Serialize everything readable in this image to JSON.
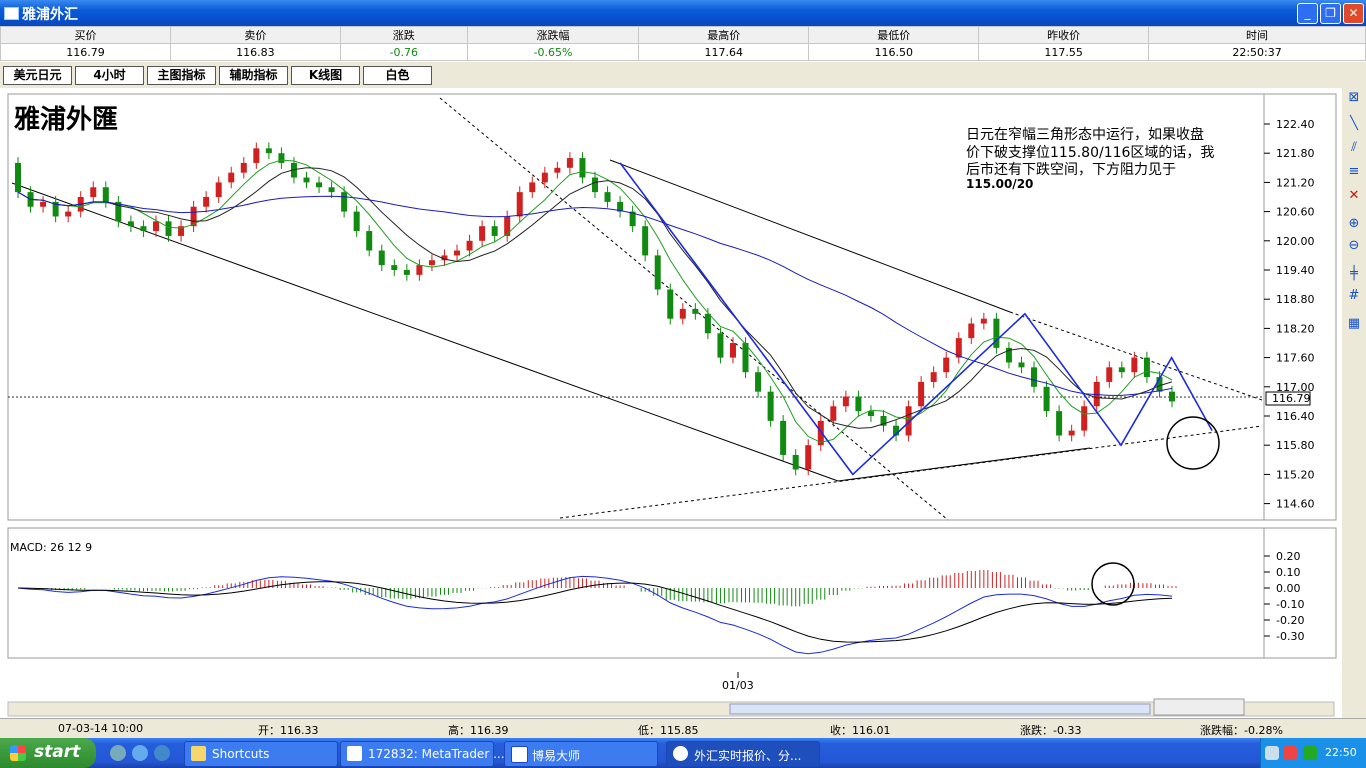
{
  "window": {
    "title": "雅浦外汇"
  },
  "quote": {
    "headers": [
      "买价",
      "卖价",
      "涨跌",
      "涨跌幅",
      "最高价",
      "最低价",
      "昨收价",
      "时间"
    ],
    "values": [
      "116.79",
      "116.83",
      "-0.76",
      "-0.65%",
      "117.64",
      "116.50",
      "117.55",
      "22:50:37"
    ]
  },
  "toolbar": {
    "buttons": [
      "美元日元",
      "4小时",
      "主图指标",
      "辅助指标",
      "K线图",
      "白色"
    ]
  },
  "chart": {
    "watermark": "雅浦外匯",
    "annotation_lines": [
      "日元在窄幅三角形态中运行，如果收盘",
      "价下破支撑位115.80/116区域的话，我",
      "后市还有下跌空间，下方阻力见于",
      "115.00/20"
    ],
    "price_labels": [
      "122.40",
      "121.80",
      "121.20",
      "120.60",
      "120.00",
      "119.40",
      "118.80",
      "118.20",
      "117.60",
      "117.00",
      "116.40",
      "115.80",
      "115.20",
      "114.60"
    ],
    "current_price": "116.79",
    "macd_label": "MACD: 26 12 9",
    "macd_labels": [
      "0.20",
      "0.10",
      "0.00",
      "-0.10",
      "-0.20",
      "-0.30"
    ],
    "date_label": "01/03",
    "colors": {
      "up": "#d02020",
      "down": "#108a10",
      "ma_long": "#1b1bc0",
      "ma_fast": "#20a020",
      "ma_slow": "#222222",
      "zigzag": "#1b2be0"
    }
  },
  "chart_data": {
    "type": "candlestick",
    "title": "",
    "xlabel": "",
    "ylabel": "",
    "ylim": [
      114.3,
      122.7
    ],
    "points": [
      [
        121.6,
        121.0
      ],
      [
        121.0,
        120.7
      ],
      [
        120.7,
        120.8
      ],
      [
        120.8,
        120.5
      ],
      [
        120.5,
        120.6
      ],
      [
        120.6,
        120.9
      ],
      [
        120.9,
        121.1
      ],
      [
        121.1,
        120.8
      ],
      [
        120.8,
        120.4
      ],
      [
        120.4,
        120.3
      ],
      [
        120.3,
        120.2
      ],
      [
        120.2,
        120.4
      ],
      [
        120.4,
        120.1
      ],
      [
        120.1,
        120.3
      ],
      [
        120.3,
        120.7
      ],
      [
        120.7,
        120.9
      ],
      [
        120.9,
        121.2
      ],
      [
        121.2,
        121.4
      ],
      [
        121.4,
        121.6
      ],
      [
        121.6,
        121.9
      ],
      [
        121.9,
        121.8
      ],
      [
        121.8,
        121.6
      ],
      [
        121.6,
        121.3
      ],
      [
        121.3,
        121.2
      ],
      [
        121.2,
        121.1
      ],
      [
        121.1,
        121.0
      ],
      [
        121.0,
        120.6
      ],
      [
        120.6,
        120.2
      ],
      [
        120.2,
        119.8
      ],
      [
        119.8,
        119.5
      ],
      [
        119.5,
        119.4
      ],
      [
        119.4,
        119.3
      ],
      [
        119.3,
        119.5
      ],
      [
        119.5,
        119.6
      ],
      [
        119.6,
        119.7
      ],
      [
        119.7,
        119.8
      ],
      [
        119.8,
        120.0
      ],
      [
        120.0,
        120.3
      ],
      [
        120.3,
        120.1
      ],
      [
        120.1,
        120.5
      ],
      [
        120.5,
        121.0
      ],
      [
        121.0,
        121.2
      ],
      [
        121.2,
        121.4
      ],
      [
        121.4,
        121.5
      ],
      [
        121.5,
        121.7
      ],
      [
        121.7,
        121.3
      ],
      [
        121.3,
        121.0
      ],
      [
        121.0,
        120.8
      ],
      [
        120.8,
        120.6
      ],
      [
        120.6,
        120.3
      ],
      [
        120.3,
        119.7
      ],
      [
        119.7,
        119.0
      ],
      [
        119.0,
        118.4
      ],
      [
        118.4,
        118.6
      ],
      [
        118.6,
        118.5
      ],
      [
        118.5,
        118.1
      ],
      [
        118.1,
        117.6
      ],
      [
        117.6,
        117.9
      ],
      [
        117.9,
        117.3
      ],
      [
        117.3,
        116.9
      ],
      [
        116.9,
        116.3
      ],
      [
        116.3,
        115.6
      ],
      [
        115.6,
        115.3
      ],
      [
        115.3,
        115.8
      ],
      [
        115.8,
        116.3
      ],
      [
        116.3,
        116.6
      ],
      [
        116.6,
        116.8
      ],
      [
        116.8,
        116.5
      ],
      [
        116.5,
        116.4
      ],
      [
        116.4,
        116.2
      ],
      [
        116.2,
        116.0
      ],
      [
        116.0,
        116.6
      ],
      [
        116.6,
        117.1
      ],
      [
        117.1,
        117.3
      ],
      [
        117.3,
        117.6
      ],
      [
        117.6,
        118.0
      ],
      [
        118.0,
        118.3
      ],
      [
        118.3,
        118.4
      ],
      [
        118.4,
        117.8
      ],
      [
        117.8,
        117.5
      ],
      [
        117.5,
        117.4
      ],
      [
        117.4,
        117.0
      ],
      [
        117.0,
        116.5
      ],
      [
        116.5,
        116.0
      ],
      [
        116.0,
        116.1
      ],
      [
        116.1,
        116.6
      ],
      [
        116.6,
        117.1
      ],
      [
        117.1,
        117.4
      ],
      [
        117.4,
        117.3
      ],
      [
        117.3,
        117.6
      ],
      [
        117.6,
        117.2
      ],
      [
        117.2,
        116.9
      ],
      [
        116.9,
        116.7
      ]
    ],
    "zigzag": [
      [
        121.6,
        0.595
      ],
      [
        115.2,
        0.825
      ],
      [
        118.5,
        0.995
      ],
      [
        115.8,
        1.09
      ],
      [
        117.6,
        1.14
      ],
      [
        116.1,
        1.18
      ]
    ]
  }
}
